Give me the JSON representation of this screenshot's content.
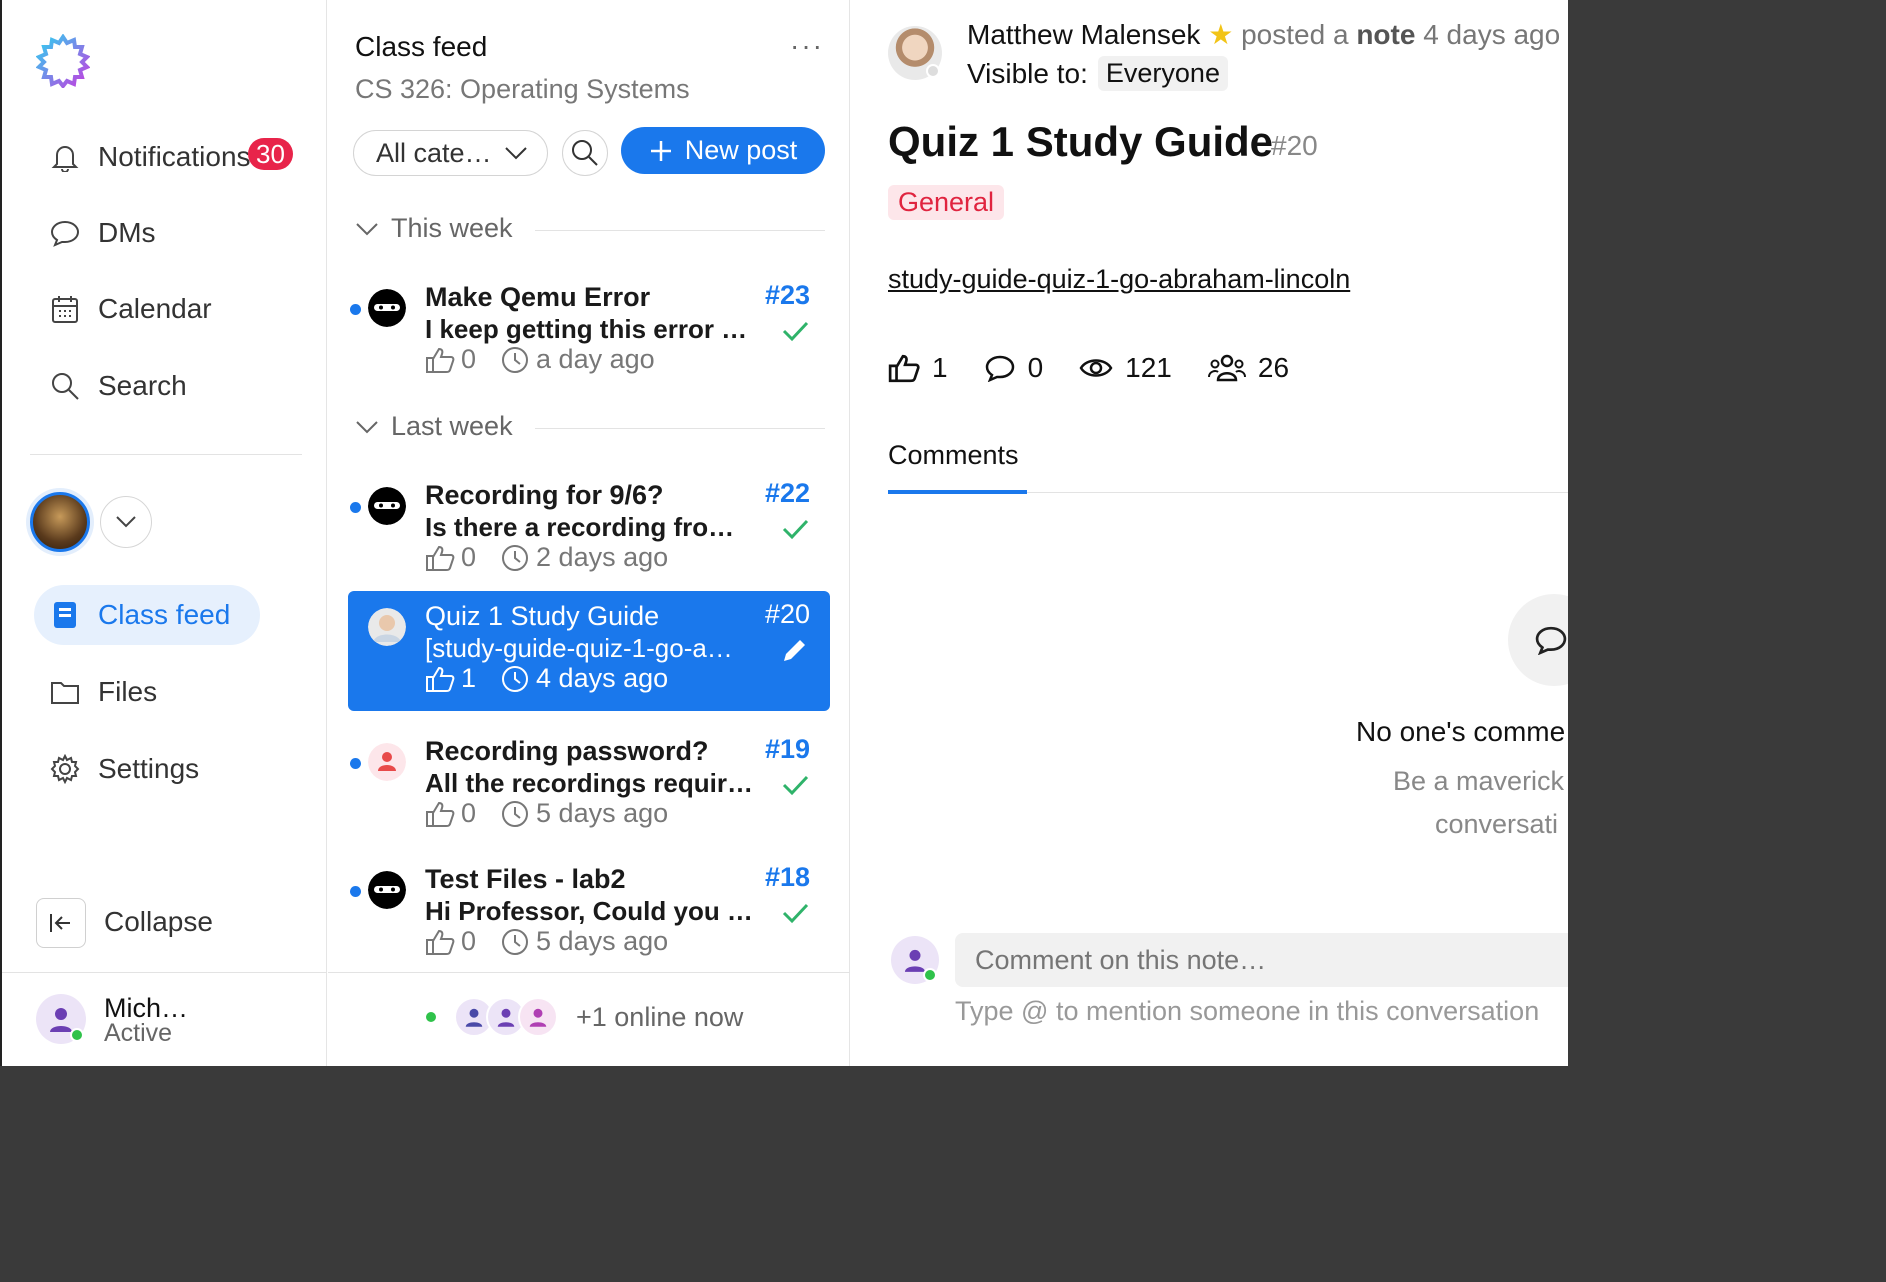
{
  "sidebar": {
    "nav": [
      {
        "label": "Notifications",
        "icon": "bell-icon"
      },
      {
        "label": "DMs",
        "icon": "chat-bubble-icon"
      },
      {
        "label": "Calendar",
        "icon": "calendar-icon"
      },
      {
        "label": "Search",
        "icon": "search-icon"
      }
    ],
    "notifications_count": "30",
    "course_nav": [
      {
        "label": "Class feed",
        "icon": "feed-icon"
      },
      {
        "label": "Files",
        "icon": "folder-icon"
      },
      {
        "label": "Settings",
        "icon": "gear-icon"
      }
    ],
    "collapse_label": "Collapse",
    "user": {
      "name": "Mich…",
      "status": "Active"
    }
  },
  "feed": {
    "title": "Class feed",
    "course": "CS 326: Operating Systems",
    "more": "···",
    "category_select": "All cate…",
    "new_post_label": "New post",
    "sections": [
      {
        "label": "This week"
      },
      {
        "label": "Last week"
      }
    ],
    "posts": [
      {
        "title": "Make Qemu Error",
        "preview": "I keep getting this error …",
        "likes": "0",
        "time": "a day ago",
        "num": "#23"
      },
      {
        "title": "Recording for 9/6?",
        "preview": "Is there a recording fro…",
        "likes": "0",
        "time": "2 days ago",
        "num": "#22"
      },
      {
        "title": "Quiz 1 Study Guide",
        "preview": "[study-guide-quiz-1-go-a…",
        "likes": "1",
        "time": "4 days ago",
        "num": "#20"
      },
      {
        "title": "Recording password?",
        "preview": "All the recordings requir…",
        "likes": "0",
        "time": "5 days ago",
        "num": "#19"
      },
      {
        "title": "Test Files - lab2",
        "preview": "Hi Professor, Could you …",
        "likes": "0",
        "time": "5 days ago",
        "num": "#18"
      }
    ],
    "online_now": "+1 online now"
  },
  "detail": {
    "author": "Matthew Malensek",
    "posted_a": "posted a",
    "post_kind": "note",
    "posted_time": "4 days ago",
    "visible_label": "Visible to:",
    "visible_value": "Everyone",
    "title": "Quiz 1 Study Guide",
    "number": "#20",
    "tag": "General",
    "link": "study-guide-quiz-1-go-abraham-lincoln",
    "stats": {
      "likes": "1",
      "comments": "0",
      "views": "121",
      "participants": "26"
    },
    "tab": "Comments",
    "empty_title": "No one's comme",
    "empty_sub1": "Be a maverick",
    "empty_sub2": "conversati",
    "comment_placeholder": "Comment on this note…",
    "comment_hint": "Type @ to mention someone in this conversation"
  },
  "colors": {
    "accent": "#1a78ec",
    "badge": "#e8244a",
    "tag_text": "#e0243f",
    "tag_bg": "#fde6ea",
    "check": "#2fb36a",
    "online": "#2fc24a"
  }
}
